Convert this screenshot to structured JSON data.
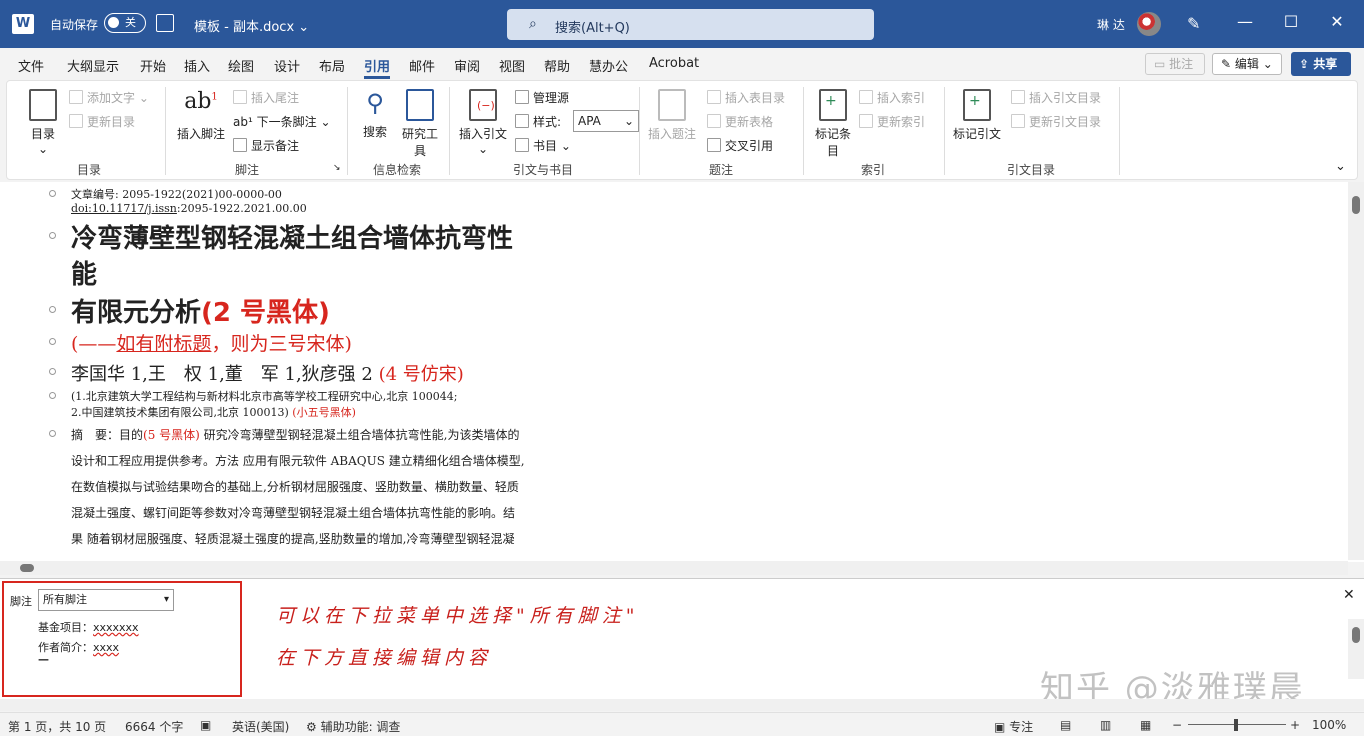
{
  "titlebar": {
    "app_logo": "W",
    "autosave_label": "自动保存",
    "autosave_state": "关",
    "document_name": "模板 - 副本.docx",
    "search_placeholder": "搜索(Alt+Q)",
    "user_name": "琳 达"
  },
  "menu": {
    "tabs": [
      "文件",
      "大纲显示",
      "开始",
      "插入",
      "绘图",
      "设计",
      "布局",
      "引用",
      "邮件",
      "审阅",
      "视图",
      "帮助",
      "慧办公",
      "Acrobat"
    ],
    "active_tab": "引用",
    "comment_label": "批注",
    "edit_label": "编辑",
    "share_label": "共享"
  },
  "ribbon": {
    "toc": {
      "button": "目录",
      "add_text": "添加文字",
      "update_toc": "更新目录",
      "group": "目录"
    },
    "footnotes": {
      "insert_footnote": "插入脚注",
      "insert_endnote": "插入尾注",
      "next_footnote": "下一条脚注",
      "show_notes": "显示备注",
      "group": "脚注"
    },
    "research": {
      "search": "搜索",
      "researcher": "研究工具",
      "group": "信息检索"
    },
    "citations": {
      "insert_citation": "插入引文",
      "manage_sources": "管理源",
      "style_label": "样式:",
      "style_value": "APA",
      "bibliography": "书目",
      "group": "引文与书目"
    },
    "captions": {
      "insert_caption": "插入题注",
      "insert_table_of_figures": "插入表目录",
      "update_table": "更新表格",
      "cross_reference": "交叉引用",
      "group": "题注"
    },
    "index": {
      "mark_entry": "标记条目",
      "insert_index": "插入索引",
      "update_index": "更新索引",
      "group": "索引"
    },
    "authorities": {
      "mark_citation": "标记引文",
      "insert_toa": "插入引文目录",
      "update_toa": "更新引文目录",
      "group": "引文目录"
    }
  },
  "document": {
    "article_no": "文章编号: 2095-1922(2021)00-0000-00",
    "doi_link": "doi:10.11717/j.issn",
    "doi_rest": ":2095-1922.2021.00.00",
    "title_line1": "冷弯薄壁型钢轻混凝土组合墙体抗弯性",
    "title_line2": "能",
    "title_line3": "有限元分析",
    "title_note": "(2 号黑体)",
    "subtitle_open": "(——",
    "subtitle_link": "如有附标题",
    "subtitle_rest": "，则为三号宋体",
    "subtitle_close": ")",
    "authors": "李国华 1,王　权 1,董　军 1,狄彦强 2 ",
    "authors_note": "(4 号仿宋)",
    "affil1": "(1.北京建筑大学工程结构与新材料北京市高等学校工程研究中心,北京  100044;",
    "affil2": "2.中国建筑技术集团有限公司,北京  100013) ",
    "affil2_note": "(小五号黑体)",
    "abstract_label": "摘　要：目的",
    "abstract_note": "(5 号黑体)",
    "abstract_lines": [
      " 研究冷弯薄壁型钢轻混凝土组合墙体抗弯性能,为该类墙体的",
      "设计和工程应用提供参考。方法  应用有限元软件 ABAQUS 建立精细化组合墙体模型,",
      "在数值模拟与试验结果吻合的基础上,分析钢材屈服强度、竖肋数量、横肋数量、轻质",
      "混凝土强度、螺钉间距等参数对冷弯薄壁型钢轻混凝土组合墙体抗弯性能的影响。结",
      "果  随着钢材屈服强度、轻质混凝土强度的提高,竖肋数量的增加,冷弯薄壁型钢轻混凝"
    ]
  },
  "footnote_pane": {
    "label": "脚注",
    "select_value": "所有脚注",
    "fund_label": "基金项目：",
    "fund_value": "xxxxxxx",
    "bio_label": "作者简介：",
    "bio_value": "xxxx",
    "separator": "—",
    "annotation_line1": "可以在下拉菜单中选择\"所有脚注\"",
    "annotation_line2": "在下方直接编辑内容",
    "watermark": "知乎 @淡雅璞晨"
  },
  "status": {
    "page": "第 1 页，共 10 页",
    "words": "6664 个字",
    "language": "英语(美国)",
    "accessibility": "辅助功能: 调查",
    "focus": "专注",
    "zoom": "100%"
  },
  "colors": {
    "brand": "#2b579a",
    "annotation_red": "#d7261e"
  }
}
